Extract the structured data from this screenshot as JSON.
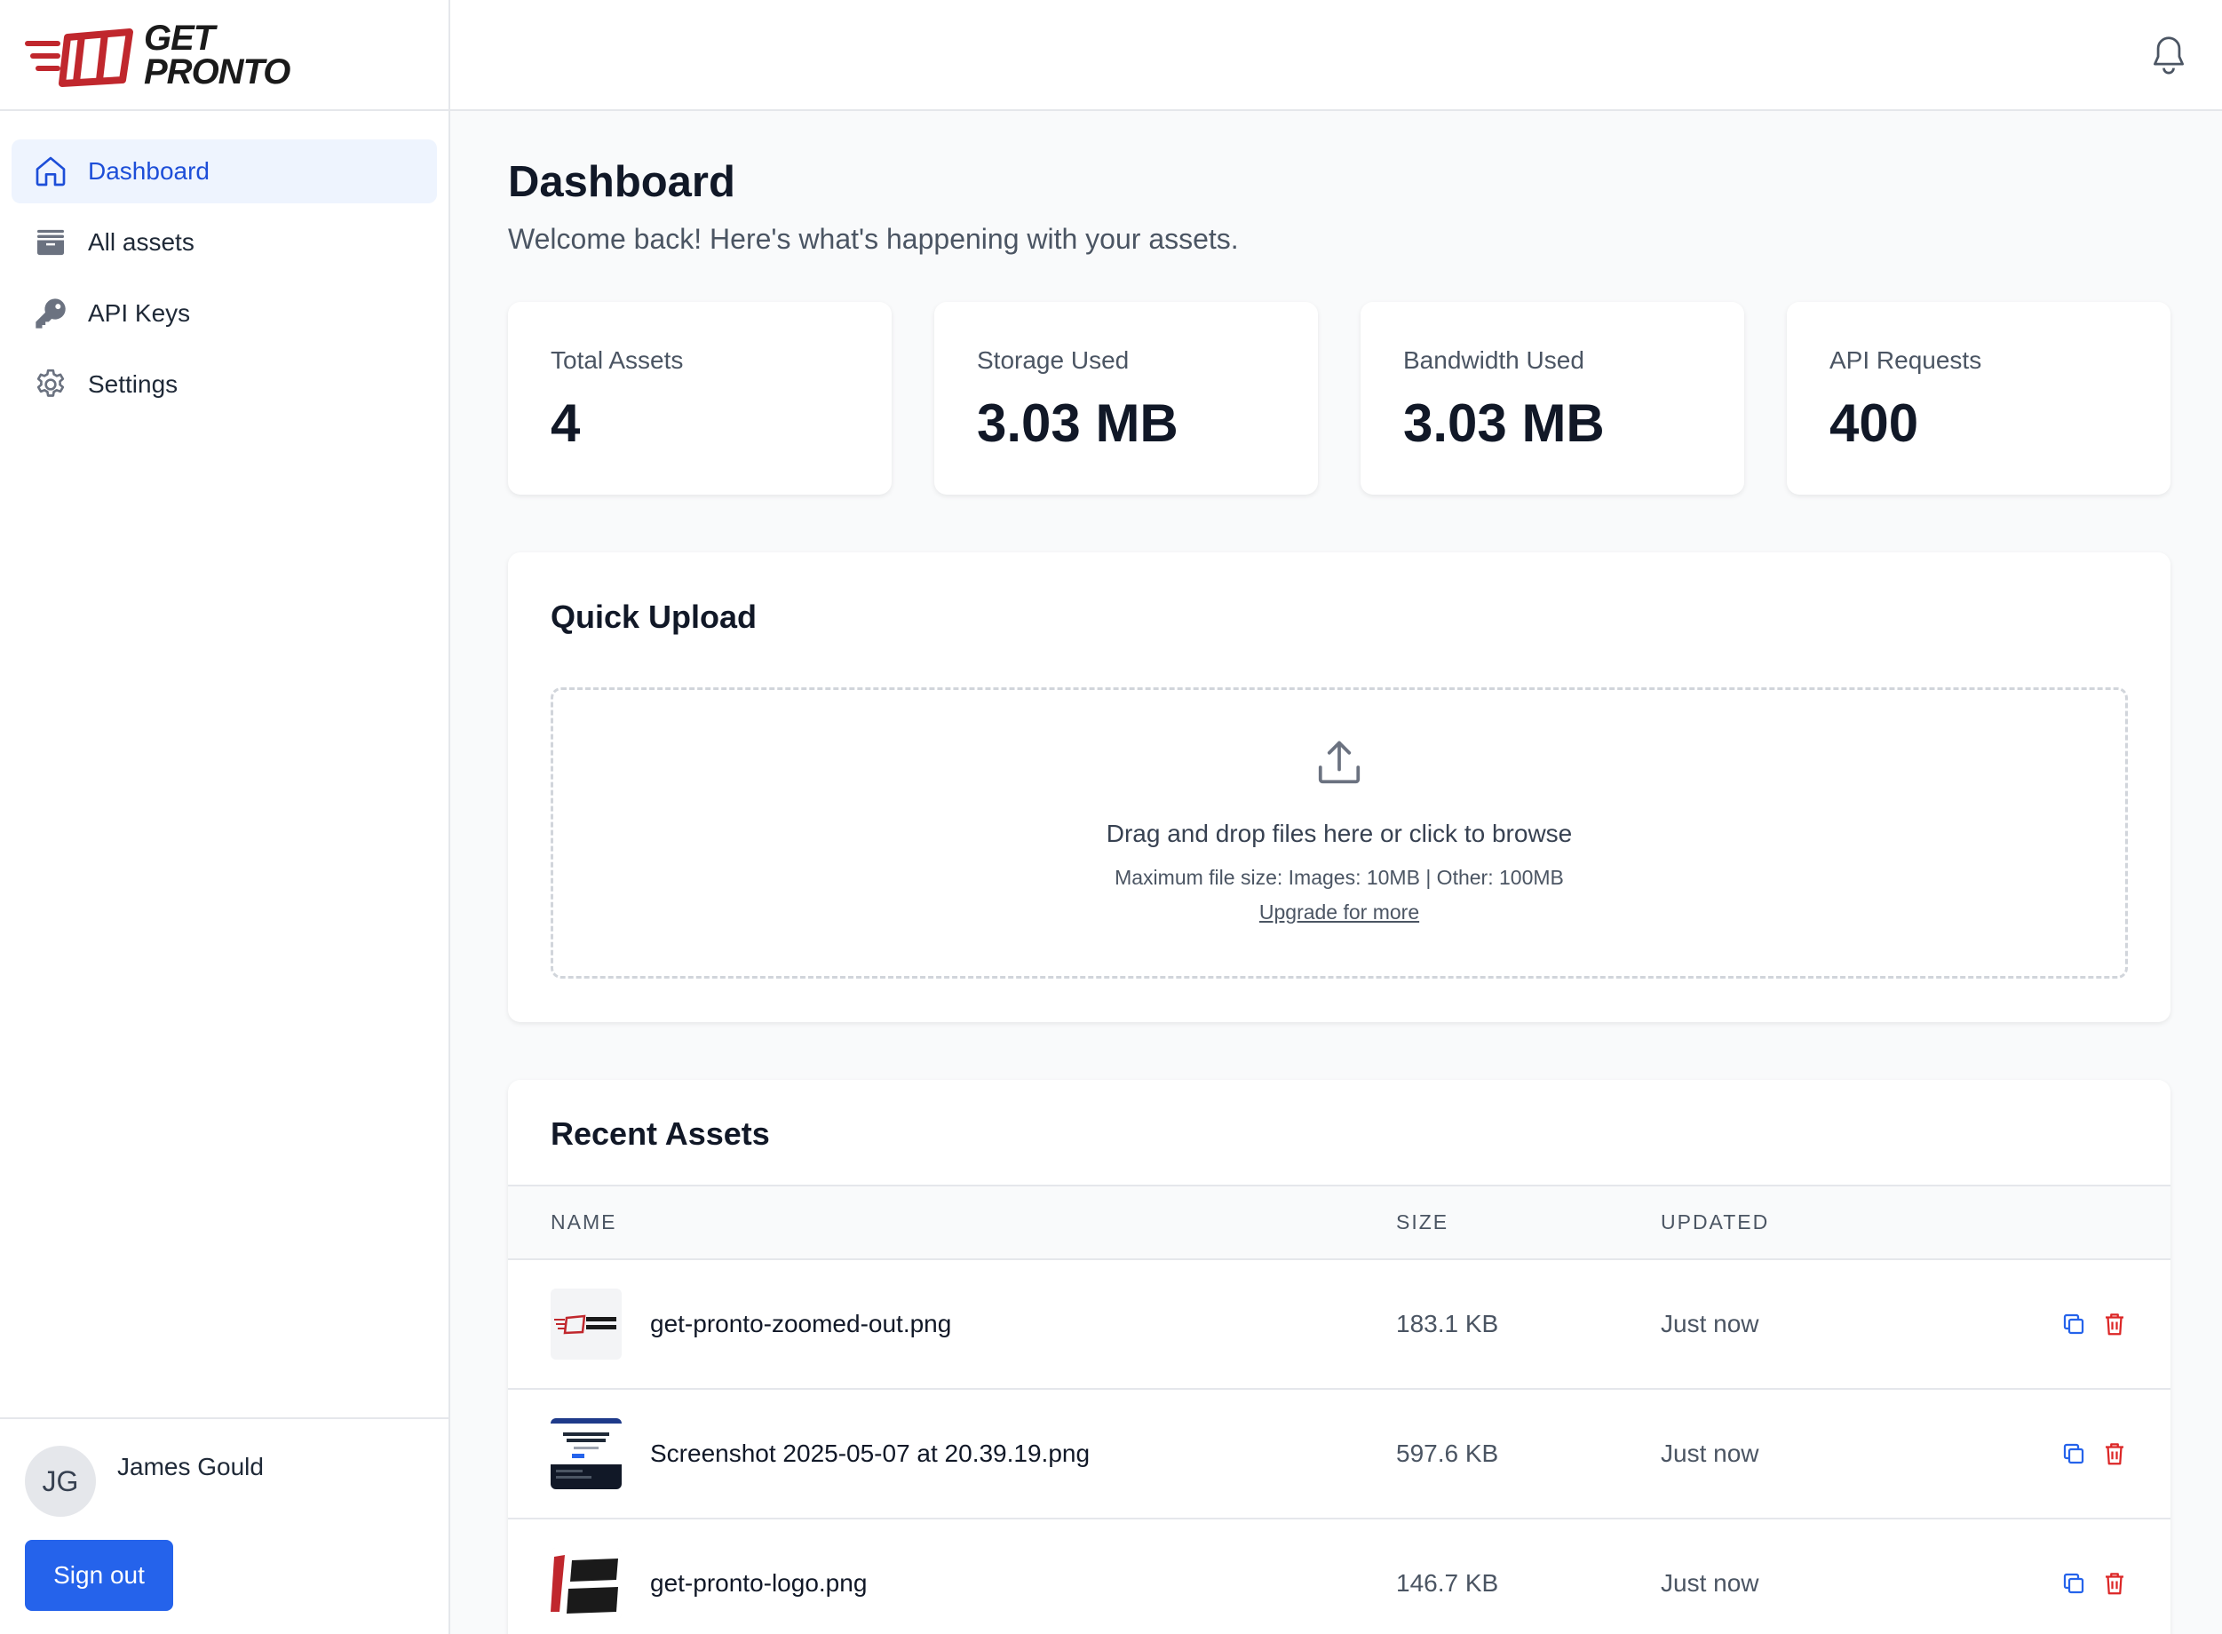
{
  "brand": {
    "logo_line1": "GET",
    "logo_line2": "PRONTO",
    "accent_color": "#c0272d"
  },
  "sidebar": {
    "items": [
      {
        "label": "Dashboard",
        "icon": "home-icon",
        "active": true
      },
      {
        "label": "All assets",
        "icon": "archive-icon",
        "active": false
      },
      {
        "label": "API Keys",
        "icon": "key-icon",
        "active": false
      },
      {
        "label": "Settings",
        "icon": "gear-icon",
        "active": false
      }
    ],
    "user": {
      "initials": "JG",
      "name": "James Gould"
    },
    "signout_label": "Sign out"
  },
  "header": {
    "notifications_icon": "bell-icon"
  },
  "main": {
    "title": "Dashboard",
    "subtitle": "Welcome back! Here's what's happening with your assets.",
    "stats": [
      {
        "label": "Total Assets",
        "value": "4"
      },
      {
        "label": "Storage Used",
        "value": "3.03 MB"
      },
      {
        "label": "Bandwidth Used",
        "value": "3.03 MB"
      },
      {
        "label": "API Requests",
        "value": "400"
      }
    ],
    "upload": {
      "title": "Quick Upload",
      "drop_text": "Drag and drop files here or click to browse",
      "limit_text": "Maximum file size: Images: 10MB | Other: 100MB",
      "upgrade_link": "Upgrade for more"
    },
    "recent": {
      "title": "Recent Assets",
      "columns": [
        "NAME",
        "SIZE",
        "UPDATED"
      ],
      "rows": [
        {
          "name": "get-pronto-zoomed-out.png",
          "size": "183.1 KB",
          "updated": "Just now"
        },
        {
          "name": "Screenshot 2025-05-07 at 20.39.19.png",
          "size": "597.6 KB",
          "updated": "Just now"
        },
        {
          "name": "get-pronto-logo.png",
          "size": "146.7 KB",
          "updated": "Just now"
        }
      ]
    }
  },
  "colors": {
    "primary": "#2563eb",
    "active_bg": "#eef4fe",
    "active_text": "#1d4ed8",
    "copy_icon": "#2563eb",
    "delete_icon": "#dc2626"
  }
}
